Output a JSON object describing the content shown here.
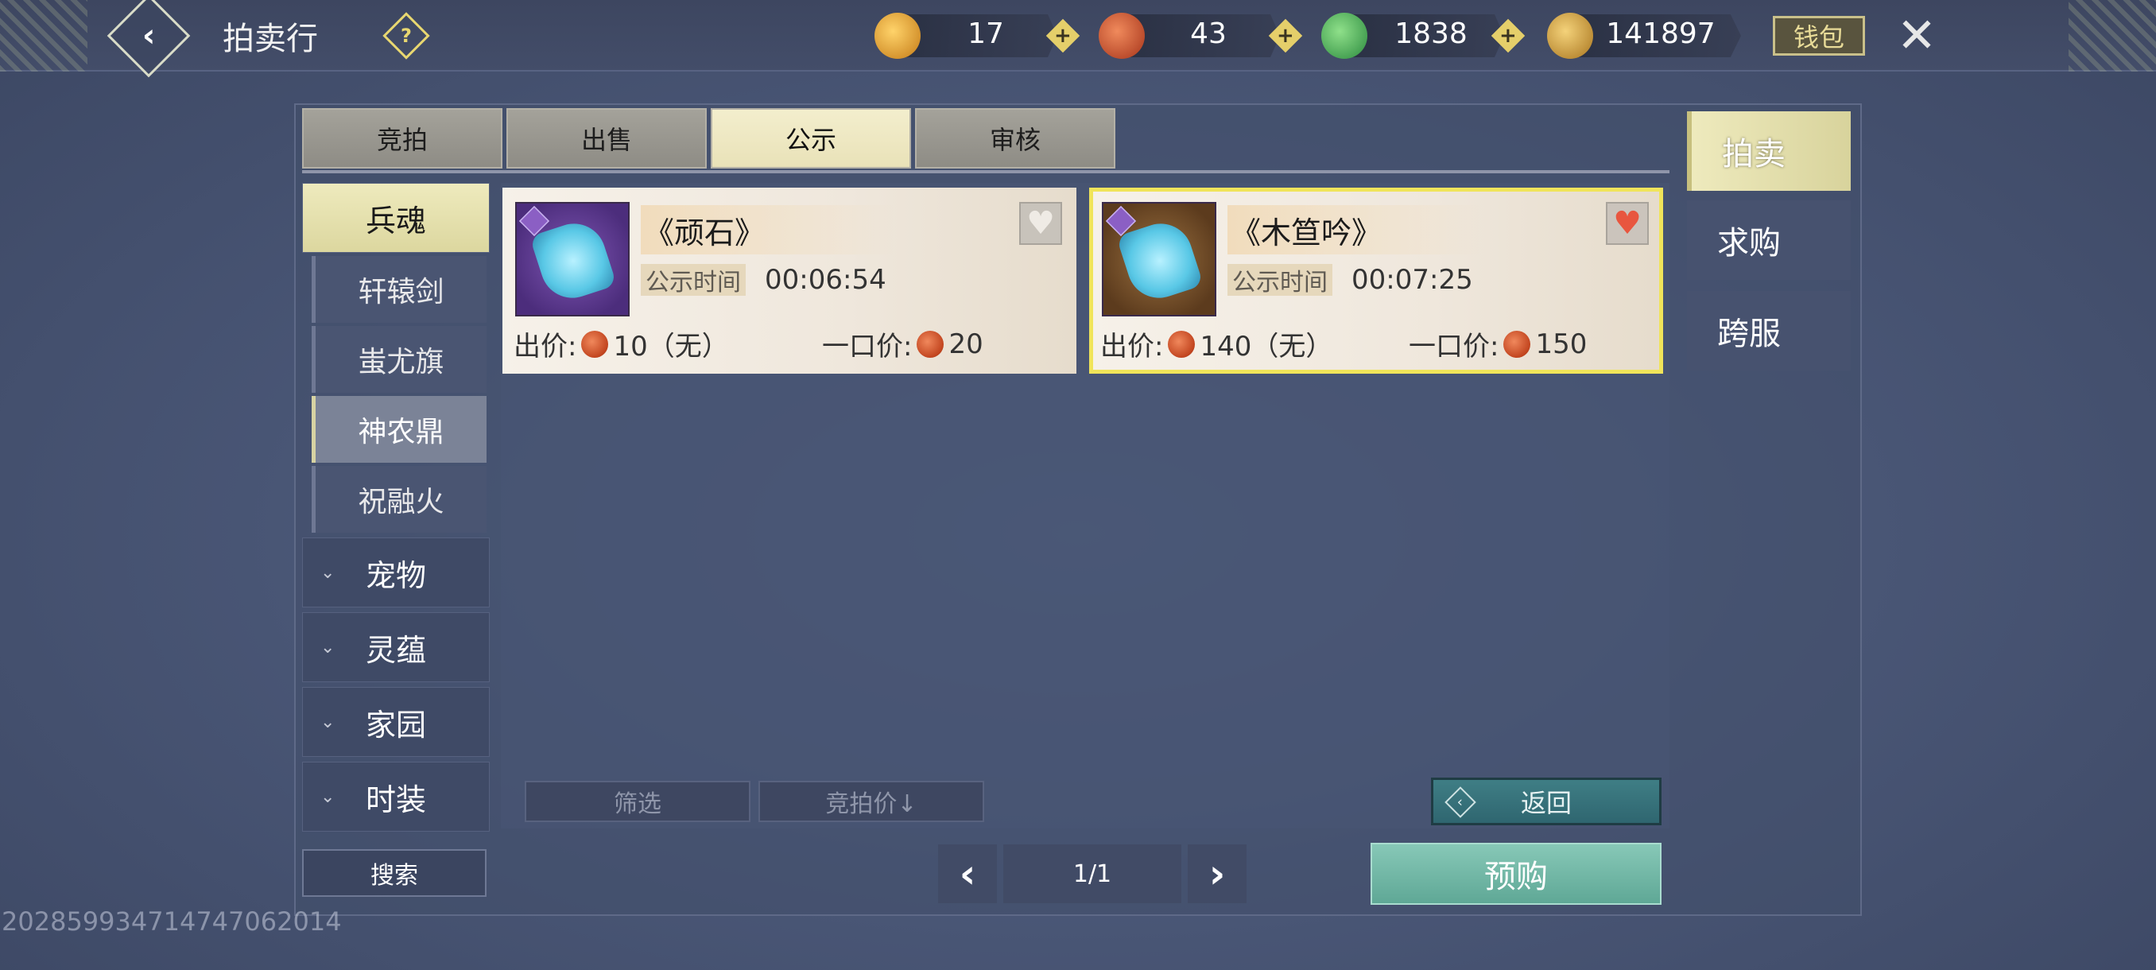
{
  "header": {
    "title": "拍卖行",
    "help_icon": "help-icon",
    "wallet_label": "钱包",
    "currencies": [
      {
        "name": "gold-ingot-icon",
        "value": "17",
        "color": "#e0a23a"
      },
      {
        "name": "red-coin-icon",
        "value": "43",
        "color": "#d2552b"
      },
      {
        "name": "jade-coin-icon",
        "value": "1838",
        "color": "#3ea85a"
      },
      {
        "name": "gold-shell-icon",
        "value": "141897",
        "color": "#c9942e"
      }
    ]
  },
  "tabs": [
    {
      "label": "竞拍",
      "active": false
    },
    {
      "label": "出售",
      "active": false
    },
    {
      "label": "公示",
      "active": true
    },
    {
      "label": "审核",
      "active": false
    }
  ],
  "categories": {
    "main_active": "兵魂",
    "sub_items": [
      {
        "label": "轩辕剑",
        "active": false
      },
      {
        "label": "蚩尤旗",
        "active": false
      },
      {
        "label": "神农鼎",
        "active": true
      },
      {
        "label": "祝融火",
        "active": false
      }
    ],
    "collapsed": [
      "宠物",
      "灵蕴",
      "家园",
      "时装"
    ]
  },
  "items": [
    {
      "name": "《顽石》",
      "pub_label": "公示时间",
      "pub_time": "00:06:54",
      "bid_label": "出价:",
      "bid_value": "10（无）",
      "buyout_label": "一口价:",
      "buyout_value": "20",
      "favorited": false,
      "selected": false
    },
    {
      "name": "《木笪吟》",
      "pub_label": "公示时间",
      "pub_time": "00:07:25",
      "bid_label": "出价:",
      "bid_value": "140（无）",
      "buyout_label": "一口价:",
      "buyout_value": "150",
      "favorited": true,
      "selected": true
    }
  ],
  "controls": {
    "filter_label": "筛选",
    "sort_label": "竞拍价↓",
    "return_label": "返回",
    "search_label": "搜索",
    "page": "1/1",
    "prebuy_label": "预购"
  },
  "side_tabs": [
    {
      "label": "拍卖",
      "active": true
    },
    {
      "label": "求购",
      "active": false
    },
    {
      "label": "跨服",
      "active": false
    }
  ],
  "watermark": "202859934714747062014"
}
